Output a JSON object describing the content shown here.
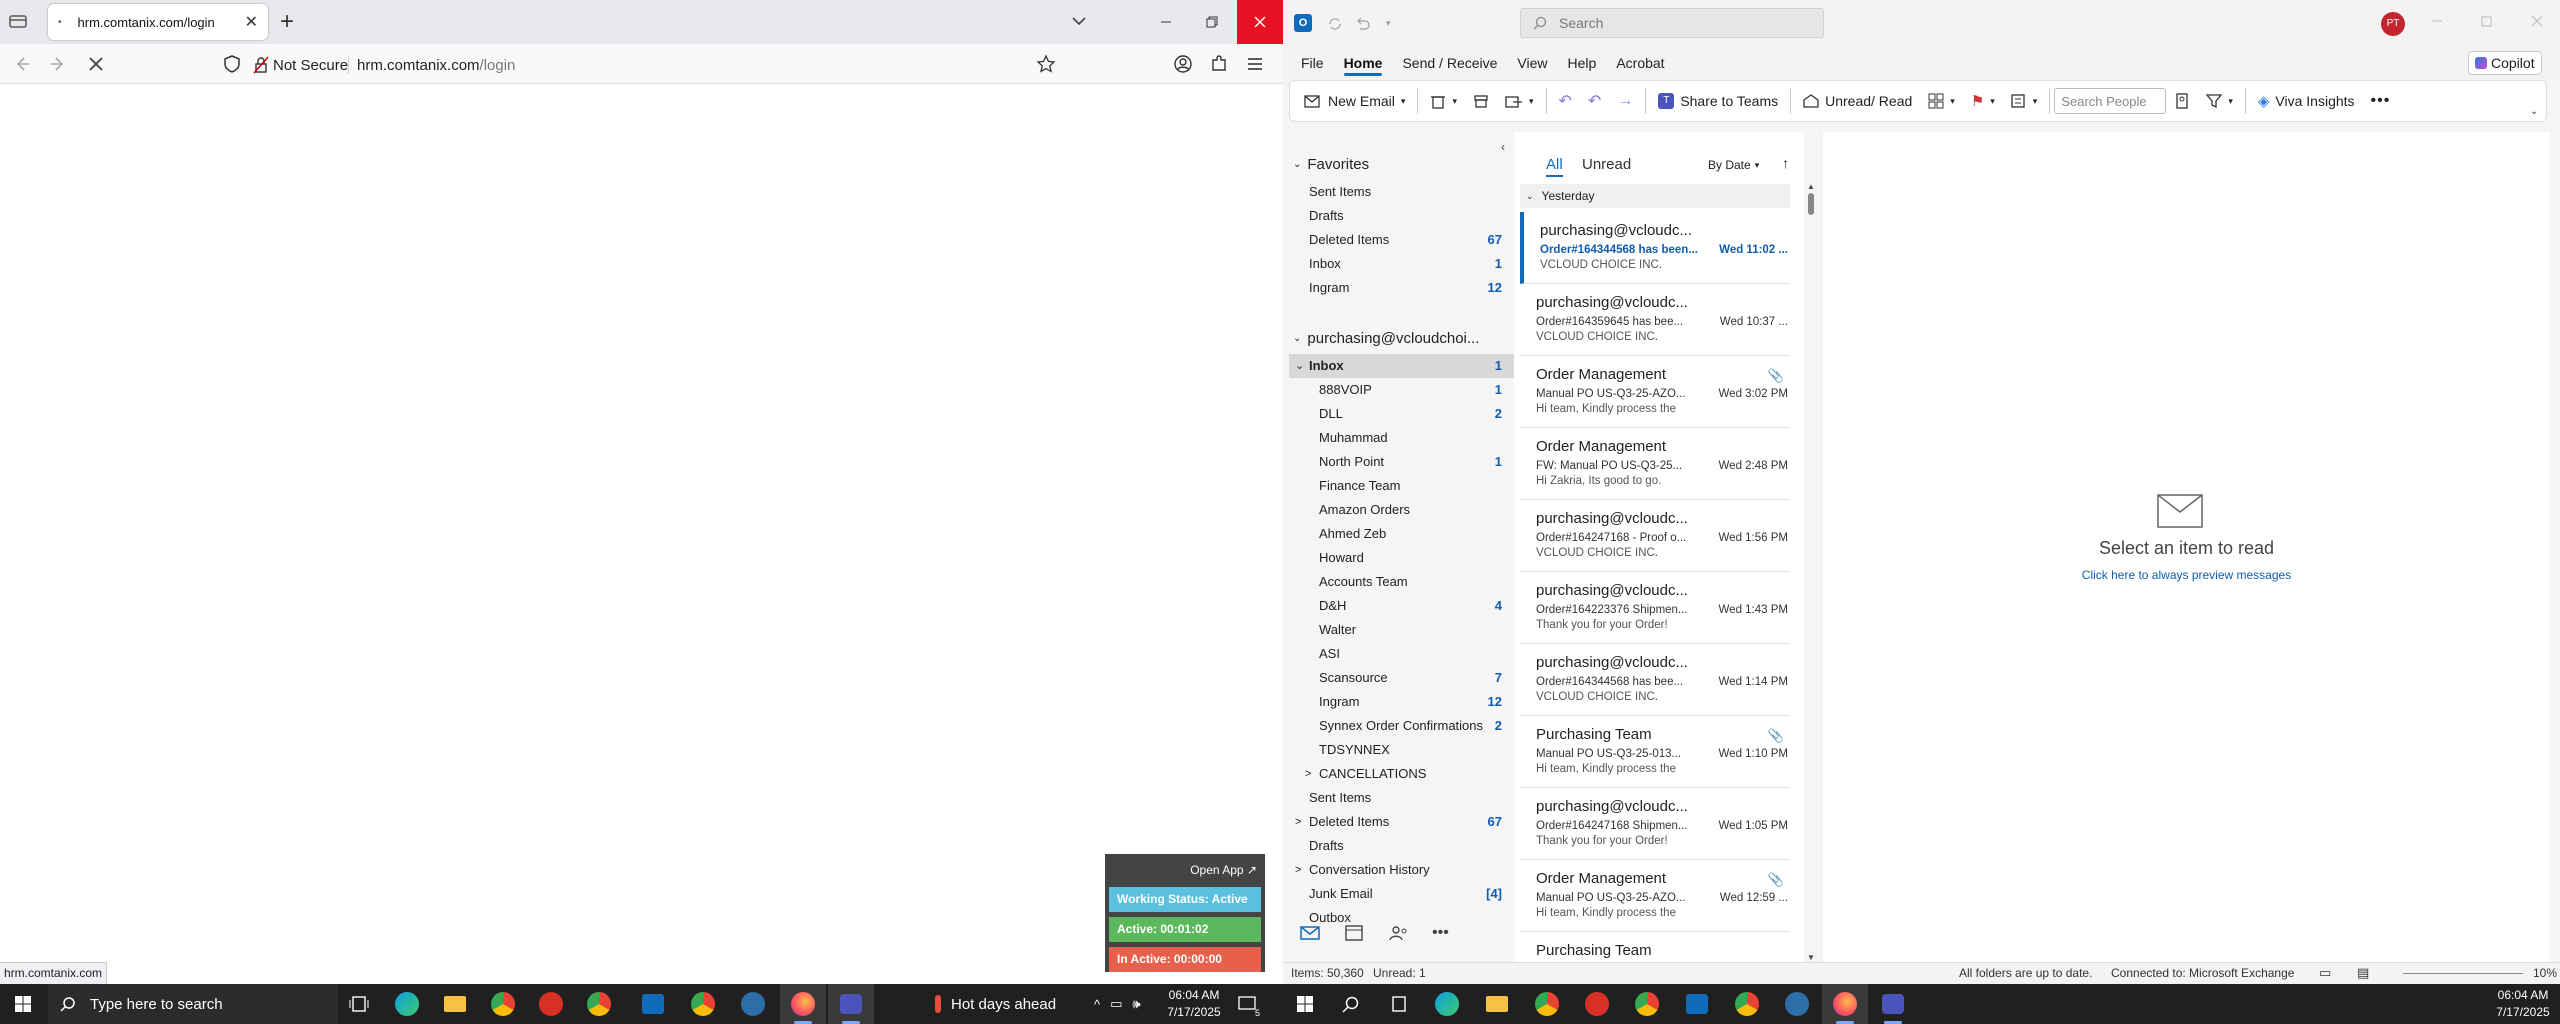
{
  "firefox": {
    "tab_title": "hrm.comtanix.com/login",
    "security_label": "Not Secure",
    "url_domain": "hrm.comtanix.com",
    "url_path": "/login",
    "status_url": "hrm.comtanix.com"
  },
  "tracker": {
    "open_app": "Open App ↗",
    "working_status": "Working Status: Active",
    "active": "Active: 00:01:02",
    "inactive": "In Active: 00:00:00",
    "colors": {
      "status": "#5bc0de",
      "active": "#5cb85c",
      "inactive": "#e8604c"
    }
  },
  "outlook": {
    "search_placeholder": "Search",
    "avatar": "PT",
    "menu": [
      "File",
      "Home",
      "Send / Receive",
      "View",
      "Help",
      "Acrobat"
    ],
    "active_menu": "Home",
    "copilot": "Copilot",
    "ribbon": {
      "new_email": "New Email",
      "share_teams": "Share to Teams",
      "unread_read": "Unread/ Read",
      "search_people_placeholder": "Search People",
      "viva": "Viva Insights"
    },
    "favorites_header": "Favorites",
    "favorites": [
      {
        "name": "Sent Items",
        "count": ""
      },
      {
        "name": "Drafts",
        "count": ""
      },
      {
        "name": "Deleted Items",
        "count": "67"
      },
      {
        "name": "Inbox",
        "count": "1"
      },
      {
        "name": "Ingram",
        "count": "12"
      }
    ],
    "account": "purchasing@vcloudchoi...",
    "folders": [
      {
        "name": "Inbox",
        "count": "1",
        "expand": "⌄"
      },
      {
        "name": "888VOIP",
        "count": "1",
        "indent": true
      },
      {
        "name": "DLL",
        "count": "2",
        "indent": true
      },
      {
        "name": "Muhammad",
        "count": "",
        "indent": true
      },
      {
        "name": "North Point",
        "count": "1",
        "indent": true
      },
      {
        "name": "Finance Team",
        "count": "",
        "indent": true
      },
      {
        "name": "Amazon Orders",
        "count": "",
        "indent": true
      },
      {
        "name": "Ahmed Zeb",
        "count": "",
        "indent": true
      },
      {
        "name": "Howard",
        "count": "",
        "indent": true
      },
      {
        "name": "Accounts Team",
        "count": "",
        "indent": true
      },
      {
        "name": "D&H",
        "count": "4",
        "indent": true
      },
      {
        "name": "Walter",
        "count": "",
        "indent": true
      },
      {
        "name": "ASI",
        "count": "",
        "indent": true
      },
      {
        "name": "Scansource",
        "count": "7",
        "indent": true
      },
      {
        "name": "Ingram",
        "count": "12",
        "indent": true
      },
      {
        "name": "Synnex Order Confirmations",
        "count": "2",
        "indent": true
      },
      {
        "name": "TDSYNNEX",
        "count": "",
        "indent": true
      },
      {
        "name": "CANCELLATIONS",
        "count": "",
        "indent": true,
        "expand": ">"
      },
      {
        "name": "Sent Items",
        "count": ""
      },
      {
        "name": "Deleted Items",
        "count": "67",
        "expand": ">"
      },
      {
        "name": "Drafts",
        "count": ""
      },
      {
        "name": "Conversation History",
        "count": "",
        "expand": ">"
      },
      {
        "name": "Junk Email",
        "count": "[4]"
      },
      {
        "name": "Outbox",
        "count": ""
      }
    ],
    "list_tabs": {
      "all": "All",
      "unread": "Unread",
      "sort": "By Date"
    },
    "group_header": "Yesterday",
    "messages": [
      {
        "sender": "purchasing@vcloudc...",
        "subject": "Order#164344568 has been...",
        "date": "Wed 11:02 ...",
        "preview": "VCLOUD CHOICE INC.",
        "selected": true
      },
      {
        "sender": "purchasing@vcloudc...",
        "subject": "Order#164359645 has bee...",
        "date": "Wed 10:37 ...",
        "preview": "VCLOUD CHOICE INC."
      },
      {
        "sender": "Order Management",
        "subject": "Manual PO   US-Q3-25-AZO...",
        "date": "Wed 3:02 PM",
        "preview": "Hi team,  Kindly process the",
        "attach": true
      },
      {
        "sender": "Order Management",
        "subject": "FW: Manual PO   US-Q3-25...",
        "date": "Wed 2:48 PM",
        "preview": "Hi Zakria,  Its good to go."
      },
      {
        "sender": "purchasing@vcloudc...",
        "subject": "Order#164247168 - Proof o...",
        "date": "Wed 1:56 PM",
        "preview": "VCLOUD CHOICE INC."
      },
      {
        "sender": "purchasing@vcloudc...",
        "subject": "Order#164223376 Shipmen...",
        "date": "Wed 1:43 PM",
        "preview": "Thank you for your Order!"
      },
      {
        "sender": "purchasing@vcloudc...",
        "subject": "Order#164344568 has bee...",
        "date": "Wed 1:14 PM",
        "preview": "VCLOUD CHOICE INC."
      },
      {
        "sender": "Purchasing Team",
        "subject": "Manual PO   US-Q3-25-013...",
        "date": "Wed 1:10 PM",
        "preview": "Hi team,  Kindly process the",
        "attach": true
      },
      {
        "sender": "purchasing@vcloudc...",
        "subject": "Order#164247168 Shipmen...",
        "date": "Wed 1:05 PM",
        "preview": "Thank you for your Order!"
      },
      {
        "sender": "Order Management",
        "subject": "Manual PO   US-Q3-25-AZO...",
        "date": "Wed 12:59 ...",
        "preview": "Hi team,  Kindly process the",
        "attach": true
      },
      {
        "sender": "Purchasing Team",
        "subject": "",
        "date": "",
        "preview": ""
      }
    ],
    "reading": {
      "select_text": "Select an item to read",
      "preview_link": "Click here to always preview messages"
    },
    "status": {
      "items": "Items: 50,360",
      "unread": "Unread: 1",
      "sync": "All folders are up to date.",
      "connection": "Connected to: Microsoft Exchange",
      "zoom": "10%"
    }
  },
  "taskbar": {
    "search_placeholder": "Type here to search",
    "weather": "Hot days ahead",
    "time": "06:04 AM",
    "date": "7/17/2025",
    "notif_count": "5",
    "time2": "06:04 AM",
    "date2": "7/17/2025"
  }
}
